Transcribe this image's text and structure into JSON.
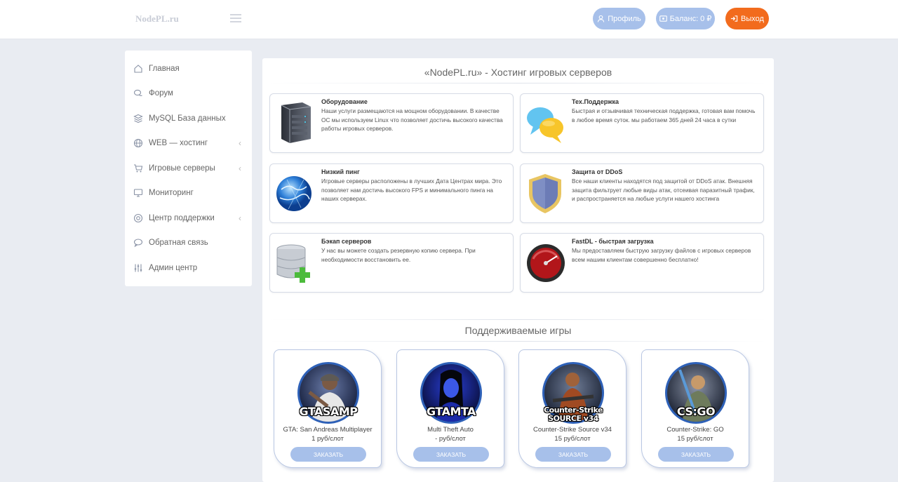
{
  "header": {
    "brand": "NodePL.ru",
    "profile_label": "Профиль",
    "balance_label": "Баланс: 0 ₽",
    "exit_label": "Выход"
  },
  "sidebar": {
    "items": [
      {
        "label": "Главная",
        "icon": "home-icon",
        "has_submenu": false
      },
      {
        "label": "Форум",
        "icon": "chat-icon",
        "has_submenu": false
      },
      {
        "label": "MySQL База данных",
        "icon": "layers-icon",
        "has_submenu": false
      },
      {
        "label": "WEB — хостинг",
        "icon": "globe-icon",
        "has_submenu": true
      },
      {
        "label": "Игровые серверы",
        "icon": "cart-icon",
        "has_submenu": true
      },
      {
        "label": "Мониторинг",
        "icon": "monitor-icon",
        "has_submenu": false
      },
      {
        "label": "Центр поддержки",
        "icon": "lifebuoy-icon",
        "has_submenu": true
      },
      {
        "label": "Обратная связь",
        "icon": "speech-bubble-icon",
        "has_submenu": false
      },
      {
        "label": "Админ центр",
        "icon": "sliders-icon",
        "has_submenu": false
      }
    ],
    "chevron": "‹"
  },
  "main": {
    "title": "«NodePL.ru» - Хостинг игровых серверов",
    "features": [
      {
        "title": "Оборудование",
        "text": "Наши услуги размещаются на мощном оборудовании. В качестве ОС мы используем Linux что позволяет достичь высокого качества работы игровых серверов.",
        "icon": "server-icon"
      },
      {
        "title": "Тех.Поддержка",
        "text": "Быстрая и отзывчивая техническая поддержка, готовая вам помочь в любое время суток. мы работаем 365 дней 24 часа в сутки",
        "icon": "speech-bubbles-icon"
      },
      {
        "title": "Низкий пинг",
        "text": "Игровые серверы расположены в лучших Дата Центрах мира. Это позволяет нам достичь высокого FPS и минимального пинга на наших серверах.",
        "icon": "globe-network-icon"
      },
      {
        "title": "Защита от DDoS",
        "text": "Все наши клиенты находятся под защитой от DDoS атак. Внешняя защита фильтрует любые виды атак, отсеивая паразитный трафик, и распространяется на любые услуги нашего хостинга",
        "icon": "shield-icon"
      },
      {
        "title": "Бэкап серверов",
        "text": "У нас вы можете создать резервную копию сервера. При необходимости восстановить ее.",
        "icon": "database-add-icon"
      },
      {
        "title": "FastDL - быстрая загрузка",
        "text": "Мы предоставляем быструю загрузку файлов с игровых серверов всем нашим клиентам совершенно бесплатно!",
        "icon": "speedometer-icon"
      }
    ],
    "games_title": "Поддерживаемые игры",
    "games": [
      {
        "logo": "GTASAMP",
        "name": "GTA: San Andreas Multiplayer",
        "price": "1 руб/слот",
        "order_label": "ЗАКАЗАТЬ"
      },
      {
        "logo": "GTAMTA",
        "name": "Multi Theft Auto",
        "price": "- руб/слот",
        "order_label": "ЗАКАЗАТЬ"
      },
      {
        "logo": "Counter-Strike SOURCE v34",
        "name": "Counter-Strike Source v34",
        "price": "15 руб/слот",
        "order_label": "ЗАКАЗАТЬ"
      },
      {
        "logo": "CS:GO",
        "name": "Counter-Strike: GO",
        "price": "15 руб/слот",
        "order_label": "ЗАКАЗАТЬ"
      }
    ]
  },
  "colors": {
    "accent": "#a7c0ea",
    "exit": "#f26b1d",
    "background": "#e9ecf2"
  }
}
